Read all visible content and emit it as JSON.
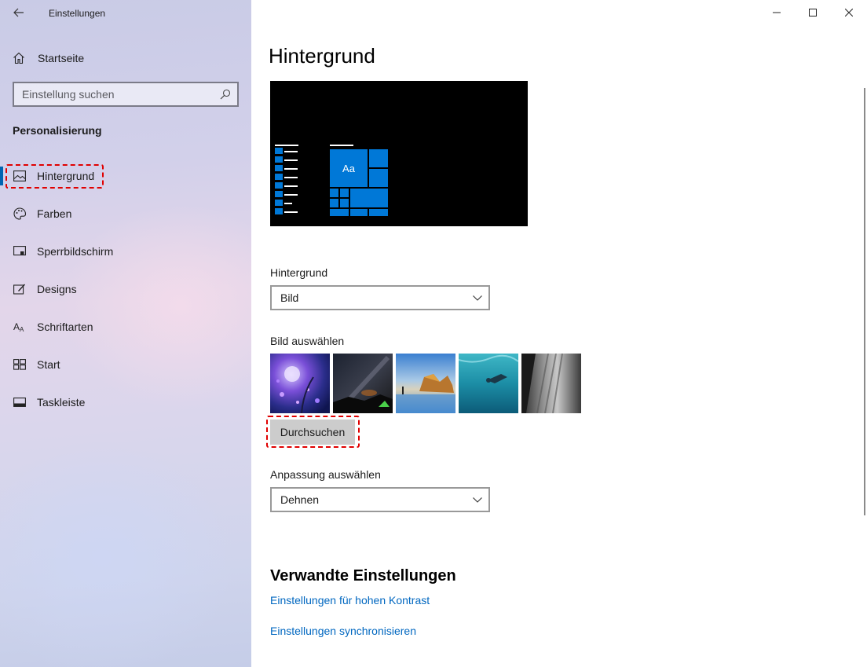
{
  "window": {
    "title": "Einstellungen",
    "controls": [
      "minimize",
      "maximize",
      "close"
    ]
  },
  "sidebar": {
    "home_label": "Startseite",
    "search_placeholder": "Einstellung suchen",
    "section_title": "Personalisierung",
    "items": [
      {
        "label": "Hintergrund",
        "icon": "picture-icon",
        "active": true
      },
      {
        "label": "Farben",
        "icon": "palette-icon",
        "active": false
      },
      {
        "label": "Sperrbildschirm",
        "icon": "lock-screen-icon",
        "active": false
      },
      {
        "label": "Designs",
        "icon": "brush-icon",
        "active": false
      },
      {
        "label": "Schriftarten",
        "icon": "font-icon",
        "active": false
      },
      {
        "label": "Start",
        "icon": "start-tiles-icon",
        "active": false
      },
      {
        "label": "Taskleiste",
        "icon": "taskbar-icon",
        "active": false
      }
    ]
  },
  "main": {
    "title": "Hintergrund",
    "preview_sample_text": "Aa",
    "background_label": "Hintergrund",
    "background_value": "Bild",
    "choose_picture_label": "Bild auswählen",
    "thumbnails": [
      "night-forest-lights",
      "milky-way-tent",
      "coastal-rock-beach",
      "underwater-swimmer",
      "rock-cliff-grayscale"
    ],
    "browse_button": "Durchsuchen",
    "fit_label": "Anpassung auswählen",
    "fit_value": "Dehnen",
    "related_title": "Verwandte Einstellungen",
    "related_links": [
      "Einstellungen für hohen Kontrast",
      "Einstellungen synchronisieren"
    ]
  },
  "colors": {
    "accent": "#0078d7",
    "link": "#0067c0",
    "highlight": "#e00000",
    "button_bg": "#cccccc"
  }
}
